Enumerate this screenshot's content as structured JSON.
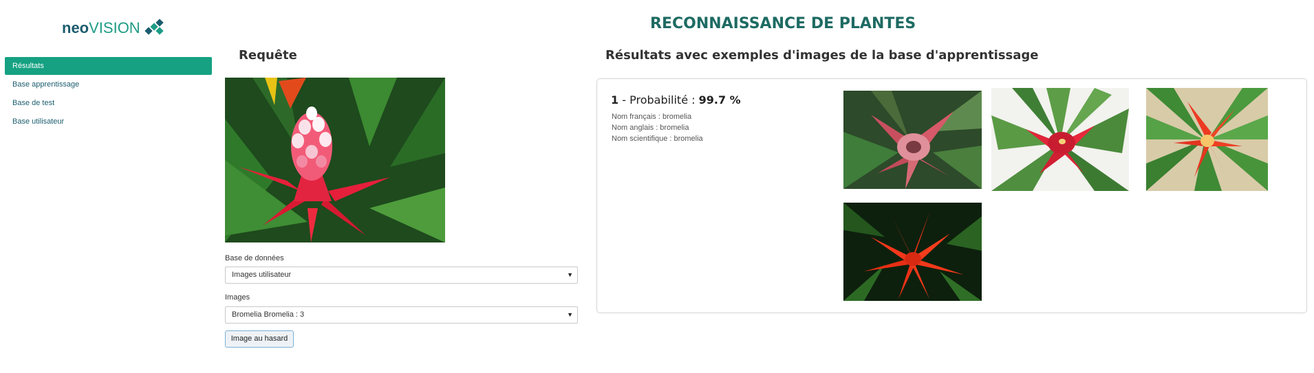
{
  "logo": {
    "text_neo": "neo",
    "text_vision": "VISION",
    "colors": {
      "neo": "#1b5c6e",
      "vision": "#1e9c86"
    }
  },
  "page": {
    "title": "RECONNAISSANCE DE PLANTES"
  },
  "sidebar": {
    "items": [
      {
        "label": "Résultats",
        "active": true
      },
      {
        "label": "Base apprentissage",
        "active": false
      },
      {
        "label": "Base de test",
        "active": false
      },
      {
        "label": "Base utilisateur",
        "active": false
      }
    ]
  },
  "query": {
    "title": "Requête",
    "image_alt": "bromelia-query-photo",
    "database_label": "Base de données",
    "database_value": "Images utilisateur",
    "images_label": "Images",
    "images_value": "Bromelia Bromelia : 3",
    "random_button": "Image au hasard"
  },
  "results": {
    "title": "Résultats avec exemples d'images de la base d'apprentissage",
    "items": [
      {
        "rank": "1",
        "prob_label": "Probabilité :",
        "prob_value": "99.7 %",
        "french_name": "Nom français : bromelia",
        "english_name": "Nom anglais : bromelia",
        "scientific_name": "Nom scientifique : bromelia",
        "examples": [
          "bromelia-example-1",
          "bromelia-example-2",
          "bromelia-example-3",
          "bromelia-example-4"
        ]
      }
    ]
  },
  "colors": {
    "accent": "#15a182",
    "title": "#1e6b63",
    "border": "#d4d4d4"
  }
}
